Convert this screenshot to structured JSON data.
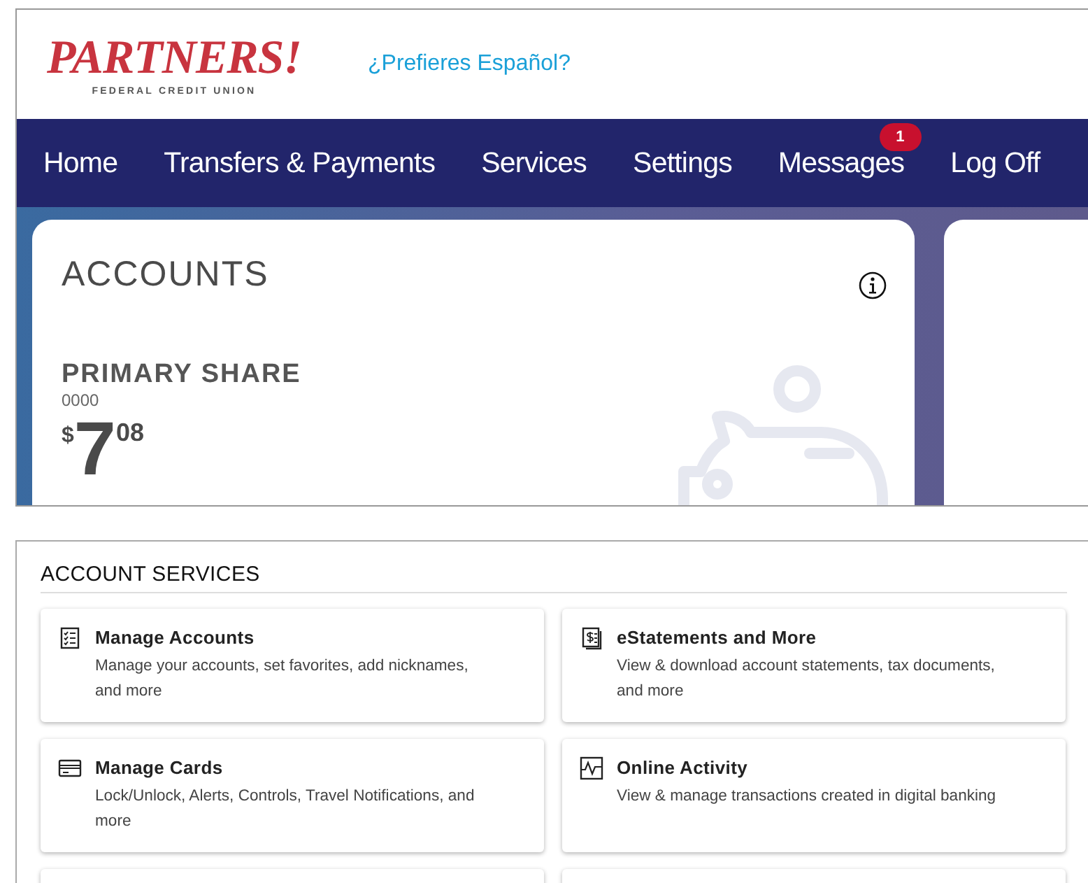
{
  "header": {
    "logo": {
      "name": "PARTNERS!",
      "tagline": "FEDERAL CREDIT UNION"
    },
    "language_link": "¿Prefieres Español?"
  },
  "nav": [
    {
      "label": "Home"
    },
    {
      "label": "Transfers & Payments"
    },
    {
      "label": "Services"
    },
    {
      "label": "Settings"
    },
    {
      "label": "Messages",
      "badge": "1"
    },
    {
      "label": "Log Off"
    }
  ],
  "accounts_card": {
    "title": "ACCOUNTS",
    "account": {
      "name": "PRIMARY SHARE",
      "number": "0000",
      "currency": "$",
      "whole": "7",
      "cents": "08"
    }
  },
  "account_services": {
    "title": "ACCOUNT SERVICES",
    "items": [
      {
        "kind": "checklist",
        "title": "Manage Accounts",
        "description": "Manage your accounts, set favorites, add nicknames, and more"
      },
      {
        "kind": "statement",
        "title": "eStatements and More",
        "description": "View & download account statements, tax documents, and more"
      },
      {
        "kind": "card",
        "title": "Manage Cards",
        "description": "Lock/Unlock, Alerts, Controls, Travel Notifications, and more"
      },
      {
        "kind": "activity",
        "title": "Online Activity",
        "description": "View & manage transactions created in digital banking"
      }
    ]
  }
}
